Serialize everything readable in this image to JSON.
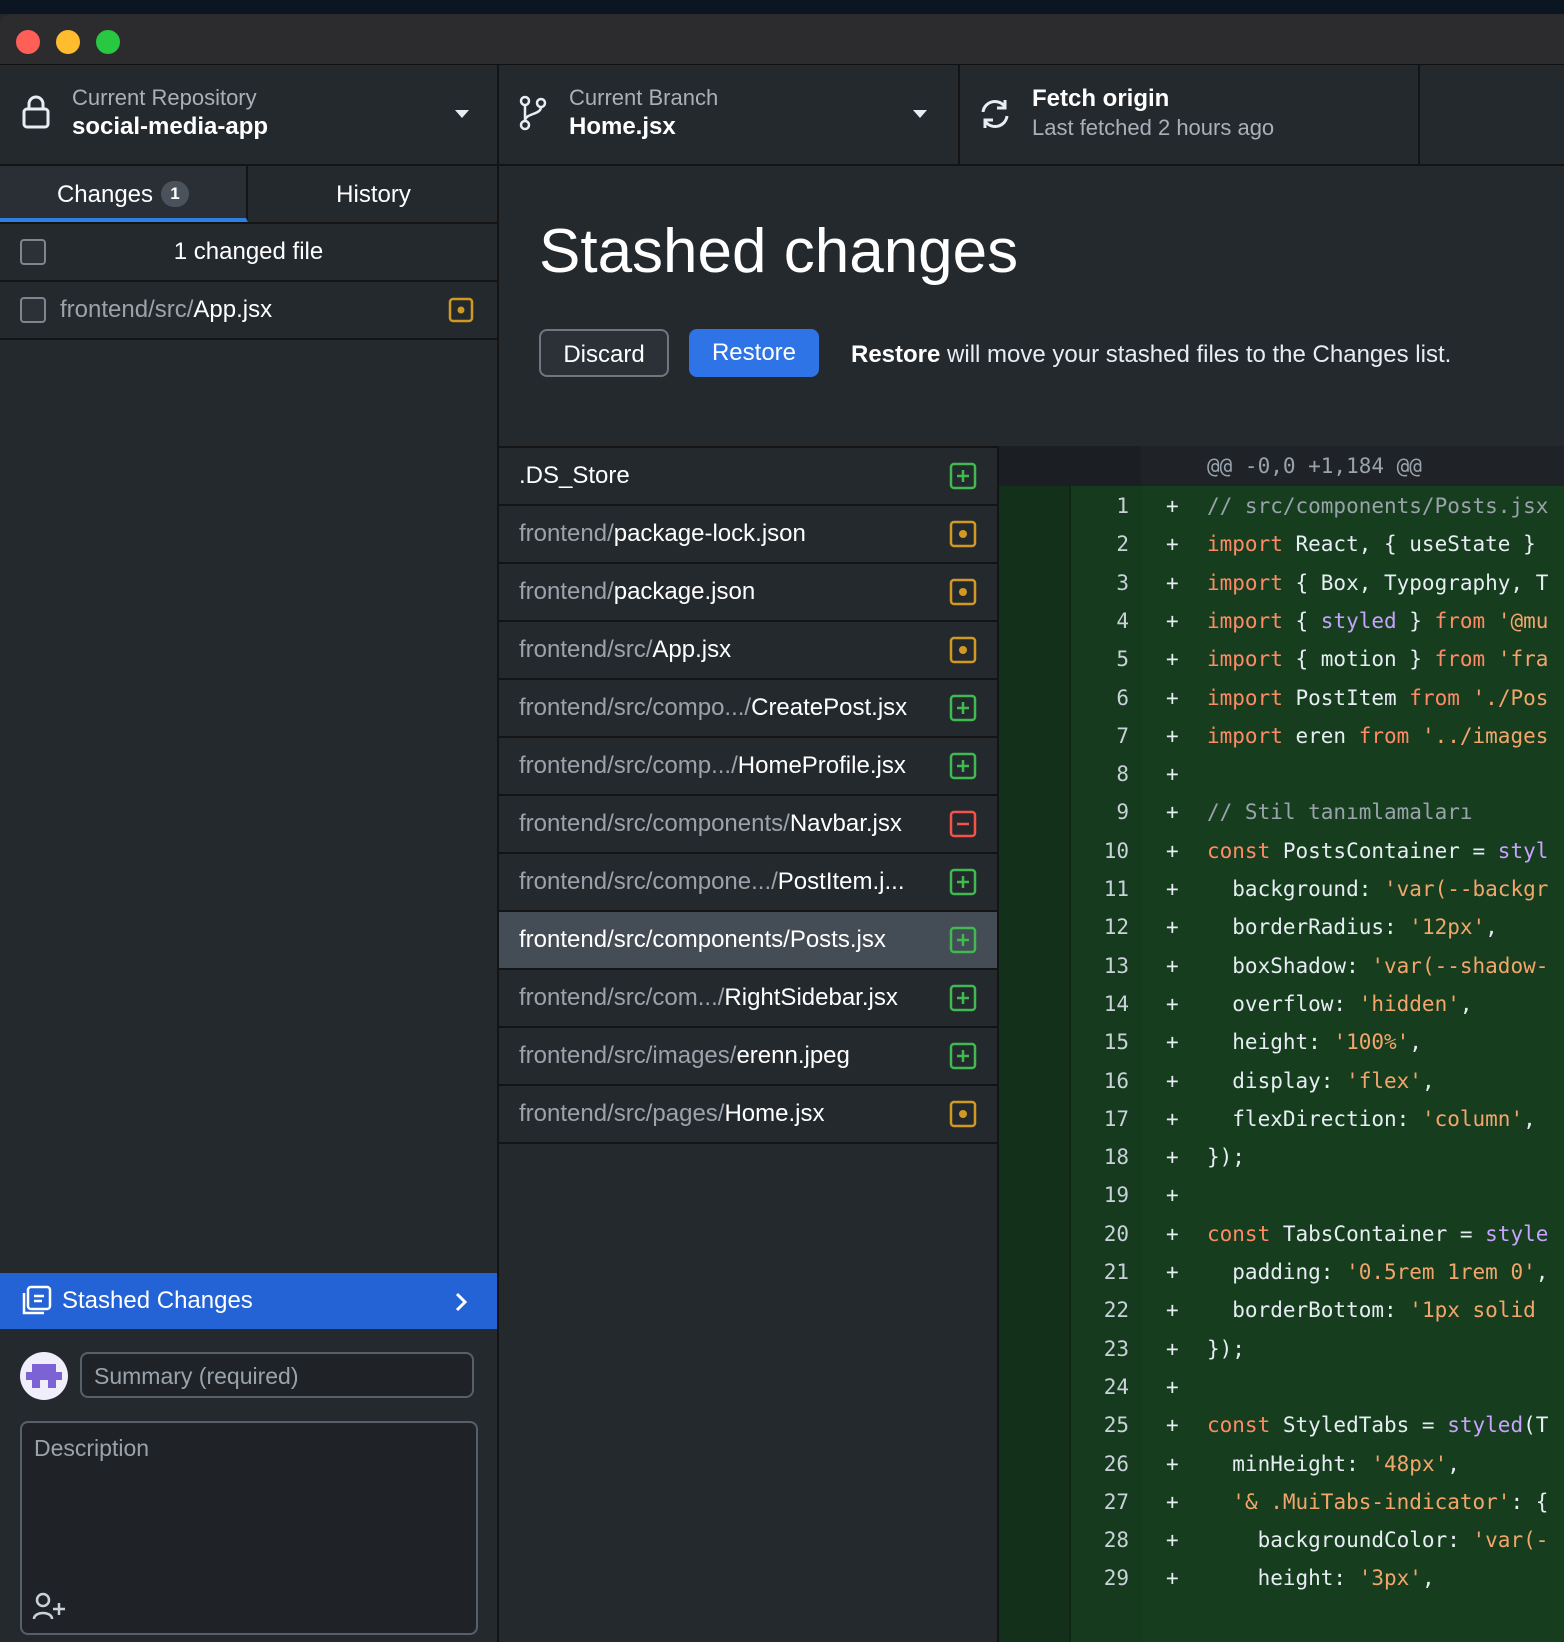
{
  "toolbar": {
    "repo_label": "Current Repository",
    "repo_value": "social-media-app",
    "branch_label": "Current Branch",
    "branch_value": "Home.jsx",
    "fetch_title": "Fetch origin",
    "fetch_sub": "Last fetched 2 hours ago"
  },
  "sidebar": {
    "tab_changes": "Changes",
    "tab_changes_count": "1",
    "tab_history": "History",
    "changed_count_label": "1 changed file",
    "changed_file_dir": "frontend/src/",
    "changed_file_name": "App.jsx",
    "stashed_label": "Stashed Changes",
    "summary_placeholder": "Summary (required)",
    "description_placeholder": "Description"
  },
  "main": {
    "heading": "Stashed changes",
    "discard_label": "Discard",
    "restore_label": "Restore",
    "hint_bold": "Restore",
    "hint_rest": " will move your stashed files to the Changes list."
  },
  "files": [
    {
      "dir": "",
      "name": ".DS_Store",
      "status": "added"
    },
    {
      "dir": "frontend/",
      "name": "package-lock.json",
      "status": "modified"
    },
    {
      "dir": "frontend/",
      "name": "package.json",
      "status": "modified"
    },
    {
      "dir": "frontend/src/",
      "name": "App.jsx",
      "status": "modified"
    },
    {
      "dir": "frontend/src/compo.../",
      "name": "CreatePost.jsx",
      "status": "added"
    },
    {
      "dir": "frontend/src/comp.../",
      "name": "HomeProfile.jsx",
      "status": "added"
    },
    {
      "dir": "frontend/src/components/",
      "name": "Navbar.jsx",
      "status": "deleted"
    },
    {
      "dir": "frontend/src/compone.../",
      "name": "PostItem.j...",
      "status": "added"
    },
    {
      "dir": "frontend/src/components/",
      "name": "Posts.jsx",
      "status": "added"
    },
    {
      "dir": "frontend/src/com.../",
      "name": "RightSidebar.jsx",
      "status": "added"
    },
    {
      "dir": "frontend/src/images/",
      "name": "erenn.jpeg",
      "status": "added"
    },
    {
      "dir": "frontend/src/pages/",
      "name": "Home.jsx",
      "status": "modified"
    }
  ],
  "selected_file_index": 8,
  "diff": {
    "hunk_header": "@@ -0,0 +1,184 @@",
    "lines": [
      {
        "n": "1",
        "code": "// src/components/Posts.jsx"
      },
      {
        "n": "2",
        "code": "import React, { useState }"
      },
      {
        "n": "3",
        "code": "import { Box, Typography, T"
      },
      {
        "n": "4",
        "code": "import { styled } from '@mu"
      },
      {
        "n": "5",
        "code": "import { motion } from 'fra"
      },
      {
        "n": "6",
        "code": "import PostItem from './Pos"
      },
      {
        "n": "7",
        "code": "import eren from '../images"
      },
      {
        "n": "8",
        "code": ""
      },
      {
        "n": "9",
        "code": "// Stil tanımlamaları"
      },
      {
        "n": "10",
        "code": "const PostsContainer = styl"
      },
      {
        "n": "11",
        "code": "  background: 'var(--backgr"
      },
      {
        "n": "12",
        "code": "  borderRadius: '12px',"
      },
      {
        "n": "13",
        "code": "  boxShadow: 'var(--shadow-"
      },
      {
        "n": "14",
        "code": "  overflow: 'hidden',"
      },
      {
        "n": "15",
        "code": "  height: '100%',"
      },
      {
        "n": "16",
        "code": "  display: 'flex',"
      },
      {
        "n": "17",
        "code": "  flexDirection: 'column',"
      },
      {
        "n": "18",
        "code": "});"
      },
      {
        "n": "19",
        "code": ""
      },
      {
        "n": "20",
        "code": "const TabsContainer = style"
      },
      {
        "n": "21",
        "code": "  padding: '0.5rem 1rem 0',"
      },
      {
        "n": "22",
        "code": "  borderBottom: '1px solid "
      },
      {
        "n": "23",
        "code": "});"
      },
      {
        "n": "24",
        "code": ""
      },
      {
        "n": "25",
        "code": "const StyledTabs = styled(T"
      },
      {
        "n": "26",
        "code": "  minHeight: '48px',"
      },
      {
        "n": "27",
        "code": "  '& .MuiTabs-indicator': {"
      },
      {
        "n": "28",
        "code": "    backgroundColor: 'var(-"
      },
      {
        "n": "29",
        "code": "    height: '3px',"
      }
    ]
  },
  "colors": {
    "accent": "#2f74e6",
    "added": "#3fb950",
    "modified": "#d29922",
    "deleted": "#f85149",
    "diff_added_bg": "#173d1f"
  },
  "icons": {
    "repo": "lock-icon",
    "branch": "branch-icon",
    "fetch": "sync-icon",
    "stash": "stash-icon",
    "chevron": "chevron-right-icon",
    "coauthor": "add-coauthor-icon"
  }
}
